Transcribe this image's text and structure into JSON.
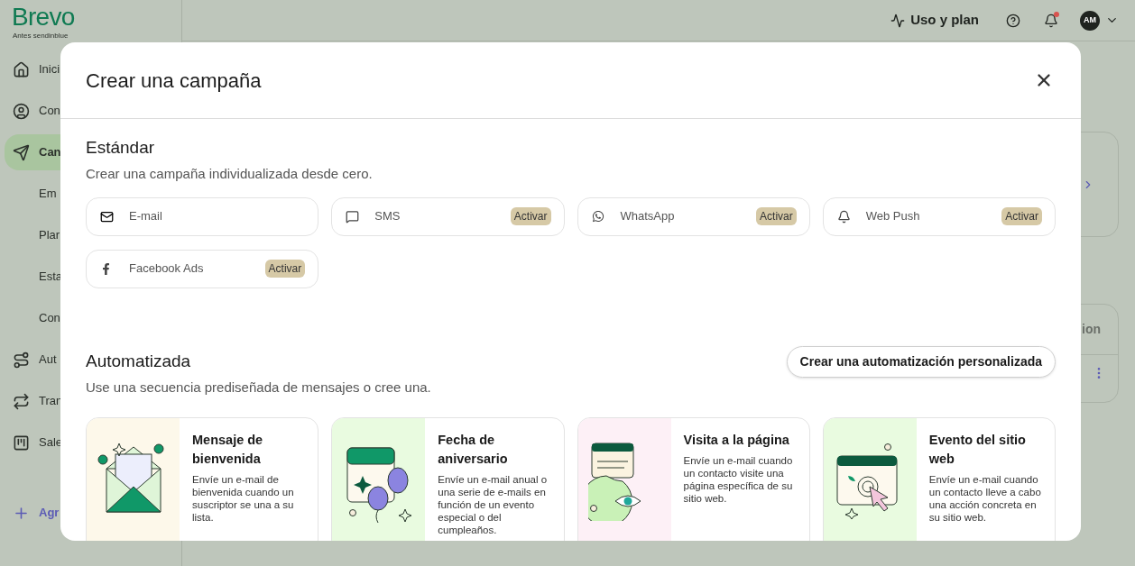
{
  "sidebar": {
    "logo": "Brevo",
    "tagline": "Antes sendinblue",
    "items": [
      {
        "kind": "home",
        "label": "Inici",
        "selected": false
      },
      {
        "kind": "contacts",
        "label": "Con",
        "selected": false
      },
      {
        "kind": "campaigns",
        "label": "Can",
        "selected": true
      },
      {
        "kind": "sub",
        "label": "Em",
        "selected": false
      },
      {
        "kind": "sub",
        "label": "Plar",
        "selected": false
      },
      {
        "kind": "sub",
        "label": "Esta",
        "selected": false
      },
      {
        "kind": "sub",
        "label": "Con",
        "selected": false
      },
      {
        "kind": "automations",
        "label": "Aut",
        "selected": false
      },
      {
        "kind": "transactional",
        "label": "Tran",
        "selected": false
      },
      {
        "kind": "sales",
        "label": "Sale",
        "selected": false
      },
      {
        "kind": "add",
        "label": "Agr",
        "selected": false
      }
    ]
  },
  "topbar": {
    "usage": "Uso y plan",
    "has_notification": true,
    "avatar": "AM"
  },
  "background": {
    "column_header": "ion"
  },
  "modal": {
    "title": "Crear una campaña",
    "standard": {
      "heading": "Estándar",
      "description": "Crear una campaña individualizada desde cero.",
      "channels": [
        {
          "kind": "email",
          "label": "E-mail"
        },
        {
          "kind": "sms",
          "label": "SMS",
          "badge": "Activar"
        },
        {
          "kind": "whatsapp",
          "label": "WhatsApp",
          "badge": "Activar"
        },
        {
          "kind": "push",
          "label": "Web Push",
          "badge": "Activar"
        },
        {
          "kind": "facebook",
          "label": "Facebook Ads",
          "badge": "Activar"
        }
      ]
    },
    "automated": {
      "heading": "Automatizada",
      "description": "Use una secuencia prediseñada de mensajes o cree una.",
      "button": "Crear una automatización personalizada",
      "cards": [
        {
          "kind": "envelope",
          "color": "#fdf8ea",
          "title": "Mensaje de bienvenida",
          "description": "Envíe un e-mail de bienvenida cuando un suscriptor se una a su lista."
        },
        {
          "kind": "calendar",
          "color": "#e9fbe0",
          "title": "Fecha de aniversario",
          "description": "Envíe un e-mail anual o una serie de e-mails en función de un evento especial o del cumpleaños."
        },
        {
          "kind": "eye",
          "color": "#fdf0f6",
          "title": "Visita a la página",
          "description": "Envíe un e-mail cuando un contacto visite una página específica de su sitio web."
        },
        {
          "kind": "cursor",
          "color": "#e9fbe0",
          "title": "Evento del sitio web",
          "description": "Envíe un e-mail cuando un contacto lleve a cabo una acción concreta en su sitio web."
        }
      ]
    }
  }
}
